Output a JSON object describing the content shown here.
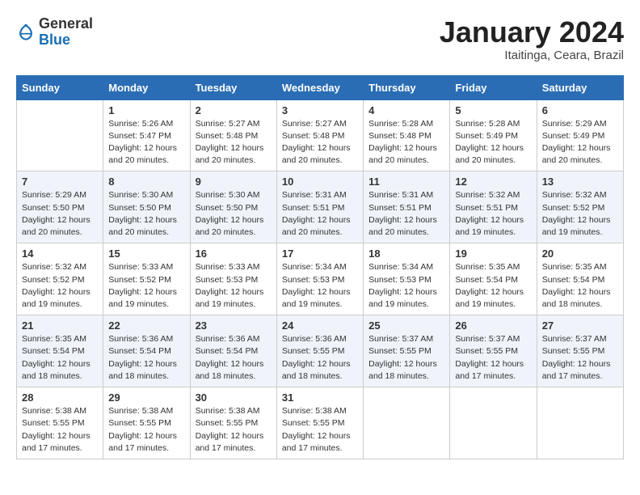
{
  "header": {
    "logo_general": "General",
    "logo_blue": "Blue",
    "month_title": "January 2024",
    "location": "Itaitinga, Ceara, Brazil"
  },
  "columns": [
    "Sunday",
    "Monday",
    "Tuesday",
    "Wednesday",
    "Thursday",
    "Friday",
    "Saturday"
  ],
  "weeks": [
    [
      {
        "day": "",
        "info": ""
      },
      {
        "day": "1",
        "info": "Sunrise: 5:26 AM\nSunset: 5:47 PM\nDaylight: 12 hours\nand 20 minutes."
      },
      {
        "day": "2",
        "info": "Sunrise: 5:27 AM\nSunset: 5:48 PM\nDaylight: 12 hours\nand 20 minutes."
      },
      {
        "day": "3",
        "info": "Sunrise: 5:27 AM\nSunset: 5:48 PM\nDaylight: 12 hours\nand 20 minutes."
      },
      {
        "day": "4",
        "info": "Sunrise: 5:28 AM\nSunset: 5:48 PM\nDaylight: 12 hours\nand 20 minutes."
      },
      {
        "day": "5",
        "info": "Sunrise: 5:28 AM\nSunset: 5:49 PM\nDaylight: 12 hours\nand 20 minutes."
      },
      {
        "day": "6",
        "info": "Sunrise: 5:29 AM\nSunset: 5:49 PM\nDaylight: 12 hours\nand 20 minutes."
      }
    ],
    [
      {
        "day": "7",
        "info": "Sunrise: 5:29 AM\nSunset: 5:50 PM\nDaylight: 12 hours\nand 20 minutes."
      },
      {
        "day": "8",
        "info": "Sunrise: 5:30 AM\nSunset: 5:50 PM\nDaylight: 12 hours\nand 20 minutes."
      },
      {
        "day": "9",
        "info": "Sunrise: 5:30 AM\nSunset: 5:50 PM\nDaylight: 12 hours\nand 20 minutes."
      },
      {
        "day": "10",
        "info": "Sunrise: 5:31 AM\nSunset: 5:51 PM\nDaylight: 12 hours\nand 20 minutes."
      },
      {
        "day": "11",
        "info": "Sunrise: 5:31 AM\nSunset: 5:51 PM\nDaylight: 12 hours\nand 20 minutes."
      },
      {
        "day": "12",
        "info": "Sunrise: 5:32 AM\nSunset: 5:51 PM\nDaylight: 12 hours\nand 19 minutes."
      },
      {
        "day": "13",
        "info": "Sunrise: 5:32 AM\nSunset: 5:52 PM\nDaylight: 12 hours\nand 19 minutes."
      }
    ],
    [
      {
        "day": "14",
        "info": "Sunrise: 5:32 AM\nSunset: 5:52 PM\nDaylight: 12 hours\nand 19 minutes."
      },
      {
        "day": "15",
        "info": "Sunrise: 5:33 AM\nSunset: 5:52 PM\nDaylight: 12 hours\nand 19 minutes."
      },
      {
        "day": "16",
        "info": "Sunrise: 5:33 AM\nSunset: 5:53 PM\nDaylight: 12 hours\nand 19 minutes."
      },
      {
        "day": "17",
        "info": "Sunrise: 5:34 AM\nSunset: 5:53 PM\nDaylight: 12 hours\nand 19 minutes."
      },
      {
        "day": "18",
        "info": "Sunrise: 5:34 AM\nSunset: 5:53 PM\nDaylight: 12 hours\nand 19 minutes."
      },
      {
        "day": "19",
        "info": "Sunrise: 5:35 AM\nSunset: 5:54 PM\nDaylight: 12 hours\nand 19 minutes."
      },
      {
        "day": "20",
        "info": "Sunrise: 5:35 AM\nSunset: 5:54 PM\nDaylight: 12 hours\nand 18 minutes."
      }
    ],
    [
      {
        "day": "21",
        "info": "Sunrise: 5:35 AM\nSunset: 5:54 PM\nDaylight: 12 hours\nand 18 minutes."
      },
      {
        "day": "22",
        "info": "Sunrise: 5:36 AM\nSunset: 5:54 PM\nDaylight: 12 hours\nand 18 minutes."
      },
      {
        "day": "23",
        "info": "Sunrise: 5:36 AM\nSunset: 5:54 PM\nDaylight: 12 hours\nand 18 minutes."
      },
      {
        "day": "24",
        "info": "Sunrise: 5:36 AM\nSunset: 5:55 PM\nDaylight: 12 hours\nand 18 minutes."
      },
      {
        "day": "25",
        "info": "Sunrise: 5:37 AM\nSunset: 5:55 PM\nDaylight: 12 hours\nand 18 minutes."
      },
      {
        "day": "26",
        "info": "Sunrise: 5:37 AM\nSunset: 5:55 PM\nDaylight: 12 hours\nand 17 minutes."
      },
      {
        "day": "27",
        "info": "Sunrise: 5:37 AM\nSunset: 5:55 PM\nDaylight: 12 hours\nand 17 minutes."
      }
    ],
    [
      {
        "day": "28",
        "info": "Sunrise: 5:38 AM\nSunset: 5:55 PM\nDaylight: 12 hours\nand 17 minutes."
      },
      {
        "day": "29",
        "info": "Sunrise: 5:38 AM\nSunset: 5:55 PM\nDaylight: 12 hours\nand 17 minutes."
      },
      {
        "day": "30",
        "info": "Sunrise: 5:38 AM\nSunset: 5:55 PM\nDaylight: 12 hours\nand 17 minutes."
      },
      {
        "day": "31",
        "info": "Sunrise: 5:38 AM\nSunset: 5:55 PM\nDaylight: 12 hours\nand 17 minutes."
      },
      {
        "day": "",
        "info": ""
      },
      {
        "day": "",
        "info": ""
      },
      {
        "day": "",
        "info": ""
      }
    ]
  ]
}
